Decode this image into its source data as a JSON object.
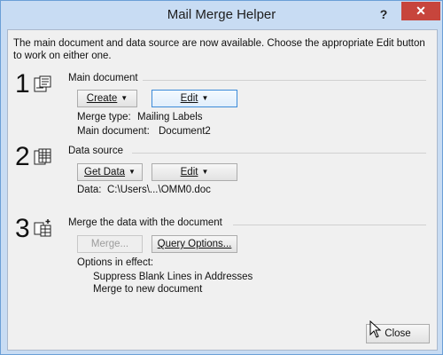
{
  "window": {
    "title": "Mail Merge Helper",
    "help_label": "?",
    "close_glyph": "✕"
  },
  "intro_text": "The main document and data source are now available. Choose the appropriate Edit button to work on either one.",
  "step1": {
    "number": "1",
    "title": "Main document",
    "create_label": "Create",
    "edit_label": "Edit",
    "merge_type_label": "Merge type:",
    "merge_type_value": "Mailing Labels",
    "main_document_label": "Main document:",
    "main_document_value": "Document2"
  },
  "step2": {
    "number": "2",
    "title": "Data source",
    "get_data_label": "Get Data",
    "edit_label": "Edit",
    "data_label": "Data:",
    "data_value": "C:\\Users\\...\\OMM0.doc"
  },
  "step3": {
    "number": "3",
    "title": "Merge the data with the document",
    "merge_label": "Merge...",
    "query_options_label": "Query Options...",
    "options_heading": "Options in effect:",
    "options": [
      "Suppress Blank Lines in Addresses",
      "Merge to new document"
    ]
  },
  "footer": {
    "close_label": "Close"
  },
  "colors": {
    "titlebar": "#c8dcf3",
    "close_button": "#c7453c",
    "focus_border": "#3c8bd9"
  }
}
